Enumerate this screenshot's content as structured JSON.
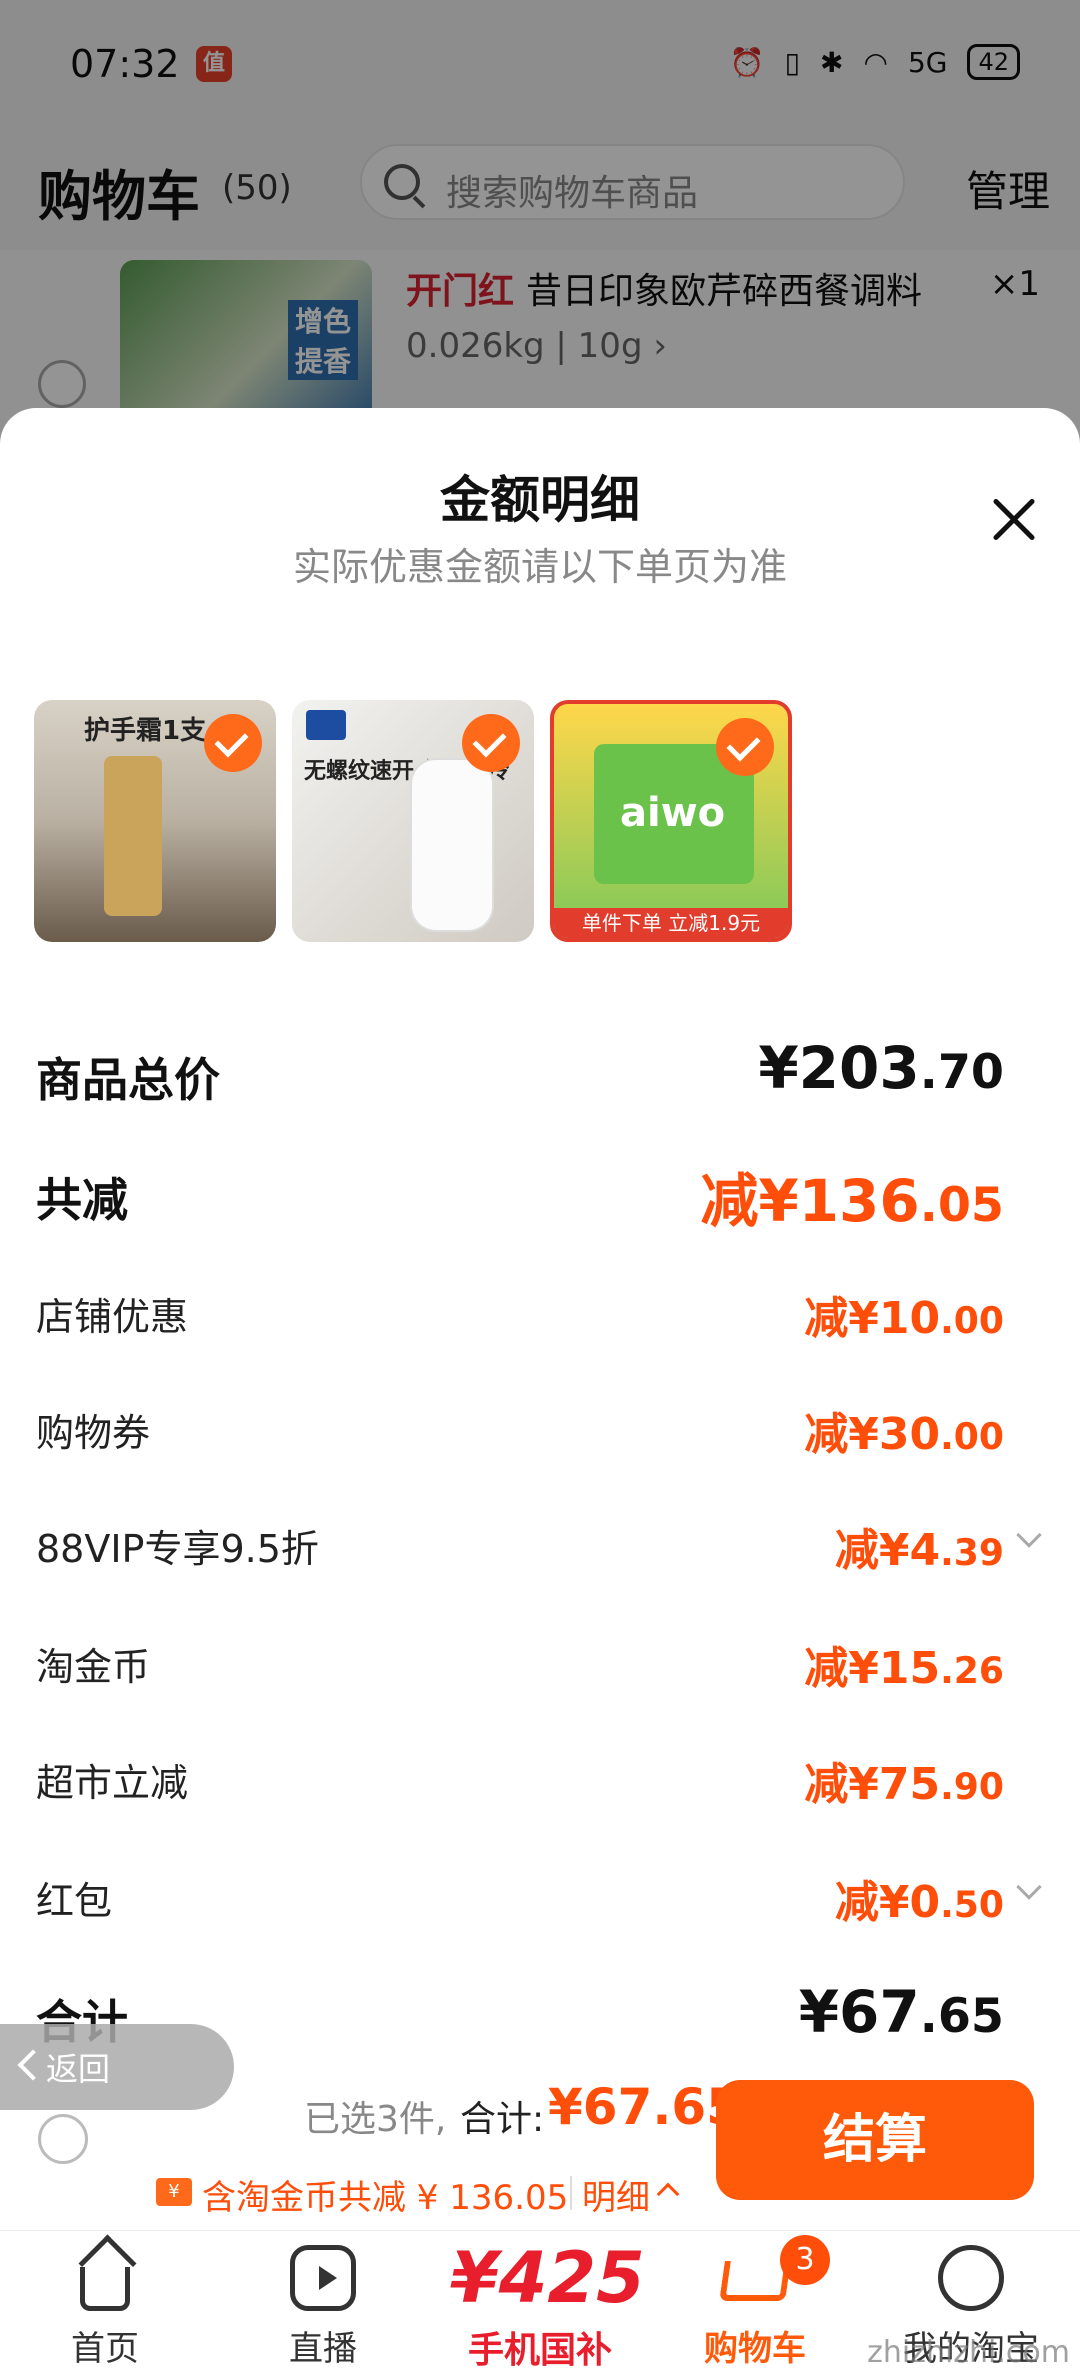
{
  "status_bar": {
    "time": "07:32",
    "app_icon": "值",
    "network": "5G",
    "battery": "42"
  },
  "header": {
    "title": "购物车",
    "count": "(50)",
    "search_placeholder": "搜索购物车商品",
    "manage": "管理"
  },
  "background_item": {
    "brand": "开门红",
    "name": "昔日印象欧芹碎西餐调料",
    "qty": "×1",
    "spec": "0.026kg | 10g ›",
    "thumb_text": "增色提香"
  },
  "sheet": {
    "title": "金额明细",
    "subtitle": "实际优惠金额请以下单页为准",
    "thumbs": [
      {
        "caption": "护手霜1支",
        "icon": "check-icon"
      },
      {
        "caption": "无螺纹速开 保温锁冷",
        "icon": "check-icon"
      },
      {
        "caption": "aiwo",
        "tag": "单件下单 立减1.9元",
        "icon": "check-icon"
      }
    ],
    "rows": {
      "subtotal": {
        "label": "商品总价",
        "int": "¥203",
        "dec": ".70"
      },
      "total_reduce": {
        "label": "共减",
        "int": "减¥136",
        "dec": ".05"
      },
      "shop": {
        "label": "店铺优惠",
        "int": "减¥10",
        "dec": ".00"
      },
      "coupon": {
        "label": "购物券",
        "int": "减¥30",
        "dec": ".00"
      },
      "vip": {
        "label": "88VIP专享9.5折",
        "int": "减¥4",
        "dec": ".39"
      },
      "taojin": {
        "label": "淘金币",
        "int": "减¥15",
        "dec": ".26"
      },
      "market": {
        "label": "超市立减",
        "int": "减¥75",
        "dec": ".90"
      },
      "redpack": {
        "label": "红包",
        "int": "减¥0",
        "dec": ".50"
      },
      "total": {
        "label": "合计",
        "int": "¥67",
        "dec": ".65"
      }
    }
  },
  "back": {
    "label": "返回"
  },
  "checkout": {
    "selected": "已选3件,",
    "total_label": "合计:",
    "price": "¥67.65",
    "coupon_icon": "¥",
    "desc": "含淘金币共减 ¥ 136.05",
    "detail": "明细",
    "button": "结算"
  },
  "tabs": {
    "home": "首页",
    "live": "直播",
    "promo_num": "¥425",
    "promo": "手机国补",
    "cart": "购物车",
    "cart_badge": "3",
    "me": "我的淘宝"
  },
  "watermark": "zhizhizhi.com",
  "colors": {
    "accent": "#ff5a0a",
    "price": "#ff4d0a",
    "promo": "#e81e2c"
  }
}
